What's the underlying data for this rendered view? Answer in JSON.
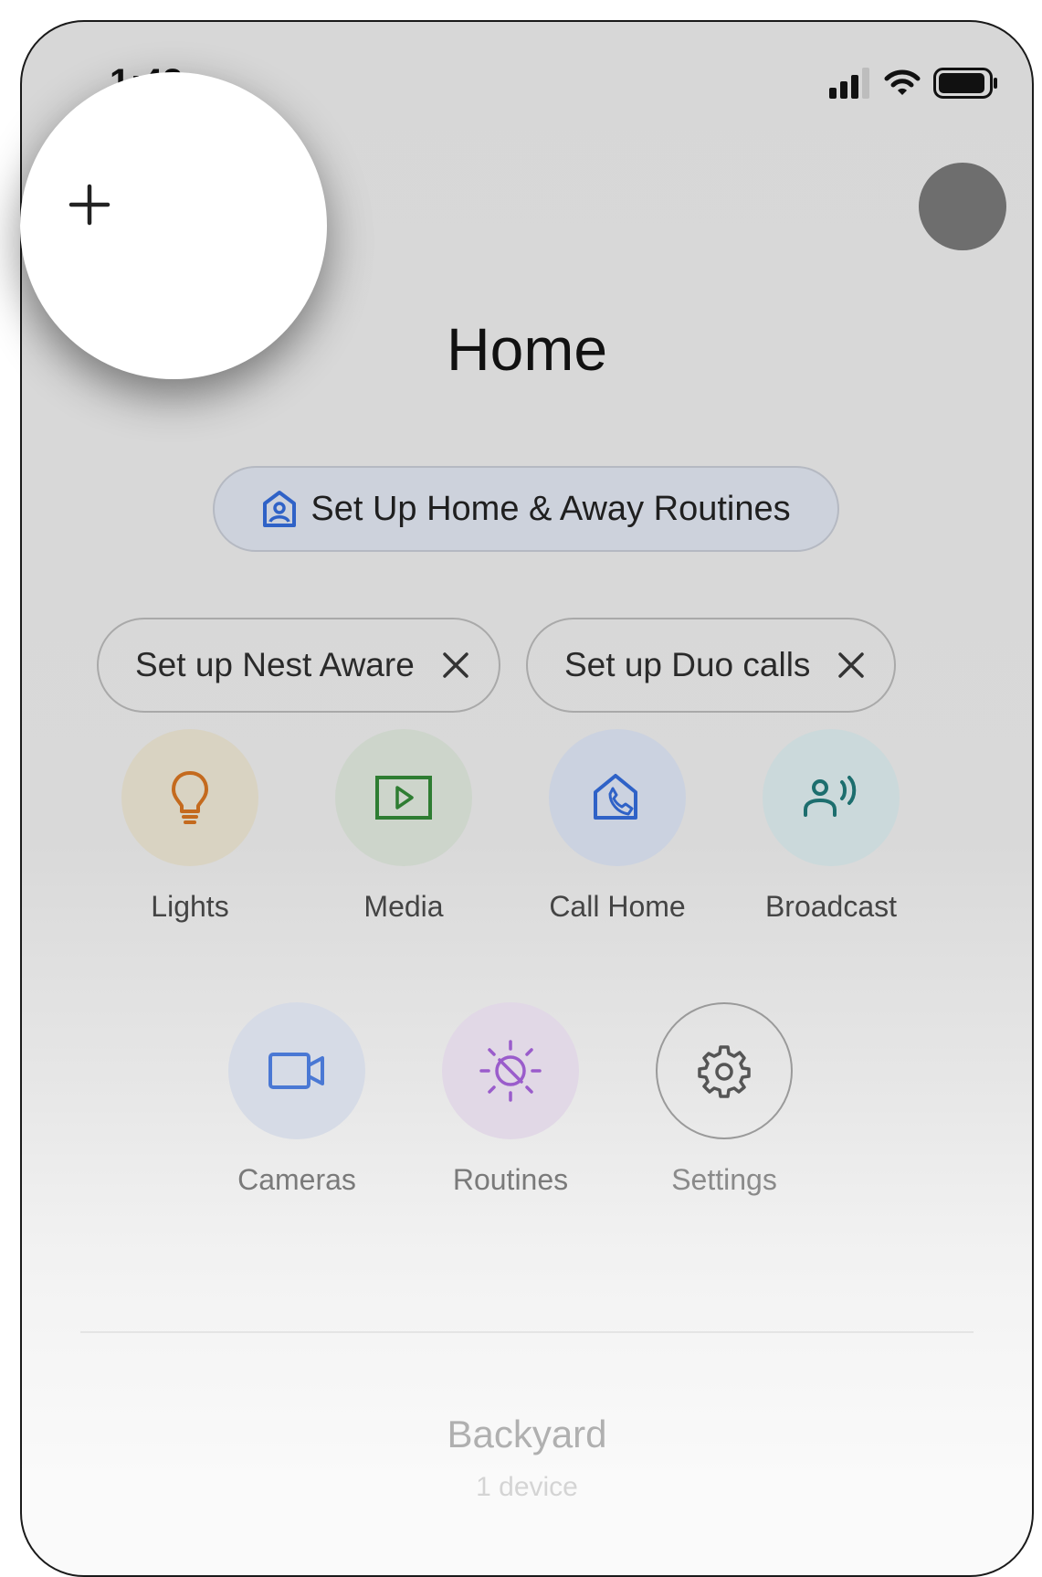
{
  "status_bar": {
    "time": "1:42"
  },
  "header": {
    "title": "Home",
    "add_icon": "plus-icon",
    "account_icon": "avatar"
  },
  "routine_chip": {
    "label": "Set Up Home & Away Routines",
    "icon": "home-person-icon"
  },
  "suggestion_chips": [
    {
      "label": "Set up Nest Aware",
      "dismiss_icon": "close-icon"
    },
    {
      "label": "Set up Duo calls",
      "dismiss_icon": "close-icon"
    }
  ],
  "actions": [
    {
      "label": "Lights",
      "icon": "lightbulb-icon",
      "bg": "#d9d3c2",
      "color": "#c46a1e"
    },
    {
      "label": "Media",
      "icon": "play-box-icon",
      "bg": "#cdd5cb",
      "color": "#2e7d32"
    },
    {
      "label": "Call Home",
      "icon": "call-home-icon",
      "bg": "#cbd2e0",
      "color": "#2f62c7"
    },
    {
      "label": "Broadcast",
      "icon": "broadcast-icon",
      "bg": "#cbd9db",
      "color": "#1d6e6e"
    },
    {
      "label": "Cameras",
      "icon": "video-camera-icon",
      "bg": "#d6dbe6",
      "color": "#4a78d4"
    },
    {
      "label": "Routines",
      "icon": "routines-sun-icon",
      "bg": "#e1d8e6",
      "color": "#9a5ccb"
    },
    {
      "label": "Settings",
      "icon": "gear-icon",
      "bg": "transparent",
      "color": "#555555"
    }
  ],
  "room": {
    "name": "Backyard",
    "device_count": "1 device"
  }
}
